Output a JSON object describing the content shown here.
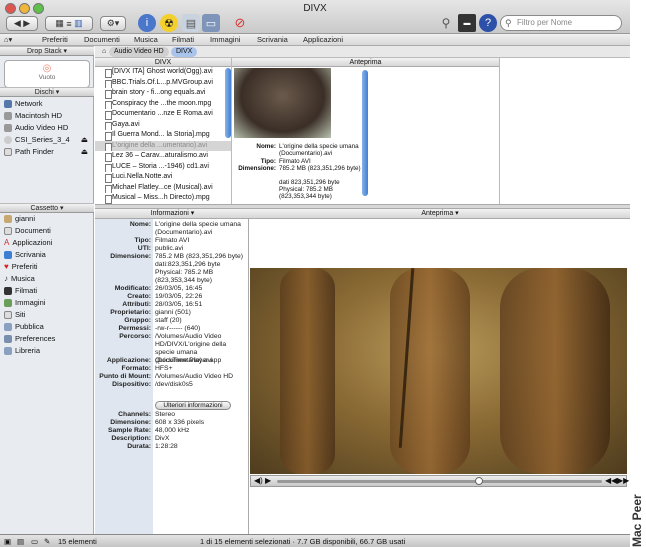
{
  "window": {
    "title": "DIVX"
  },
  "search": {
    "placeholder": "Filtro per Nome"
  },
  "menubar": {
    "items": [
      "Preferiti",
      "Documenti",
      "Musica",
      "Filmati",
      "Immagini",
      "Scrivania",
      "Applicazioni"
    ]
  },
  "path": {
    "items": [
      "Audio Video HD",
      "DIVX"
    ]
  },
  "sidebar": {
    "drop_stack": {
      "header": "Drop Stack",
      "label": "Vuoto"
    },
    "disks": {
      "header": "Dischi",
      "items": [
        "Network",
        "Macintosh HD",
        "Audio Video HD",
        "CSI_Series_3_4",
        "Path Finder"
      ]
    },
    "drawer": {
      "header": "Cassetto",
      "items": [
        "gianni",
        "Documenti",
        "Applicazioni",
        "Scrivania",
        "Preferiti",
        "Musica",
        "Filmati",
        "Immagini",
        "Siti",
        "Pubblica",
        "Preferences",
        "Libreria"
      ]
    }
  },
  "file_list": {
    "header": "DIVX",
    "files": [
      "[DIVX ITA] Ghost world(Ogg).avi",
      "BBC.Trials.Of.L...p.MVGroup.avi",
      "brain story - fi...ong equals.avi",
      "Conspiracy the ...the moon.mpg",
      "Documentario ...nze E Roma.avi",
      "Gaya.avi",
      "Il Guerra Mond... la Storia].mpg",
      "L'origine della ...umentario).avi",
      "Lez 36 – Carav...aturalismo.avi",
      "LUCE – Storia ...-1946) cd1.avi",
      "Luci.Nella.Notte.avi",
      "Michael Flatley...ce (Musical).avi",
      "Musical – Miss...h Directo).mpg"
    ],
    "selected_index": 7
  },
  "top_preview": {
    "header": "Anteprima",
    "name_label": "Nome:",
    "name": "L'origine della specie umana (Documentario).avi",
    "kind_label": "Tipo:",
    "kind": "Filmato AVI",
    "size_label": "Dimensione:",
    "size": "785.2 MB (823,351,296 byte)",
    "data": "dati 823,351,296 byte",
    "physical": "Physical: 785.2 MB",
    "physical_bytes": "(823,353,344 byte)"
  },
  "info_panel": {
    "header": "Informazioni",
    "rows": [
      {
        "k": "Nome:",
        "v": "L'origine della specie umana (Documentario).avi"
      },
      {
        "k": "Tipo:",
        "v": "Filmato AVI"
      },
      {
        "k": "UTI:",
        "v": "public.avi"
      },
      {
        "k": "Dimensione:",
        "v": "785.2 MB (823,351,296 byte)"
      },
      {
        "k": "",
        "v": "dati:823,351,296 byte"
      },
      {
        "k": "",
        "v": "Physical: 785.2 MB"
      },
      {
        "k": "",
        "v": "(823,353,344 byte)"
      },
      {
        "k": "Modificato:",
        "v": "26/03/05, 16:45"
      },
      {
        "k": "Creato:",
        "v": "19/03/05, 22:26"
      },
      {
        "k": "Attributi:",
        "v": "28/03/05, 16:51"
      },
      {
        "k": "Proprietario:",
        "v": "gianni (501)"
      },
      {
        "k": "Gruppo:",
        "v": "staff (20)"
      },
      {
        "k": "Permessi:",
        "v": "-rw-r------ (640)"
      },
      {
        "k": "Percorso:",
        "v": "/Volumes/Audio Video HD/DIVX/L'origine della specie umana (Documentario).avi"
      },
      {
        "k": "Applicazione:",
        "v": "QuickTime Player.app"
      },
      {
        "k": "Formato:",
        "v": "HFS+"
      },
      {
        "k": "Punto di Mount:",
        "v": "/Volumes/Audio Video HD"
      },
      {
        "k": "Dispositivo:",
        "v": "/dev/disk0s5"
      }
    ],
    "more_button": "Ulteriori informazioni",
    "media_rows": [
      {
        "k": "Channels:",
        "v": "Stereo"
      },
      {
        "k": "Dimensione:",
        "v": "608 x 336 pixels"
      },
      {
        "k": "Sample Rate:",
        "v": "48,000 kHz"
      },
      {
        "k": "Description:",
        "v": "DivX"
      },
      {
        "k": "Durata:",
        "v": "1:28:28"
      }
    ]
  },
  "preview_panel": {
    "header": "Anteprima",
    "playback_position": 0.62
  },
  "status": {
    "count": "15 elementi",
    "summary": "1 di 15 elementi selezionati · 7.7 GB disponibili, 66.7 GB usati"
  },
  "watermark": "Mac Peer"
}
